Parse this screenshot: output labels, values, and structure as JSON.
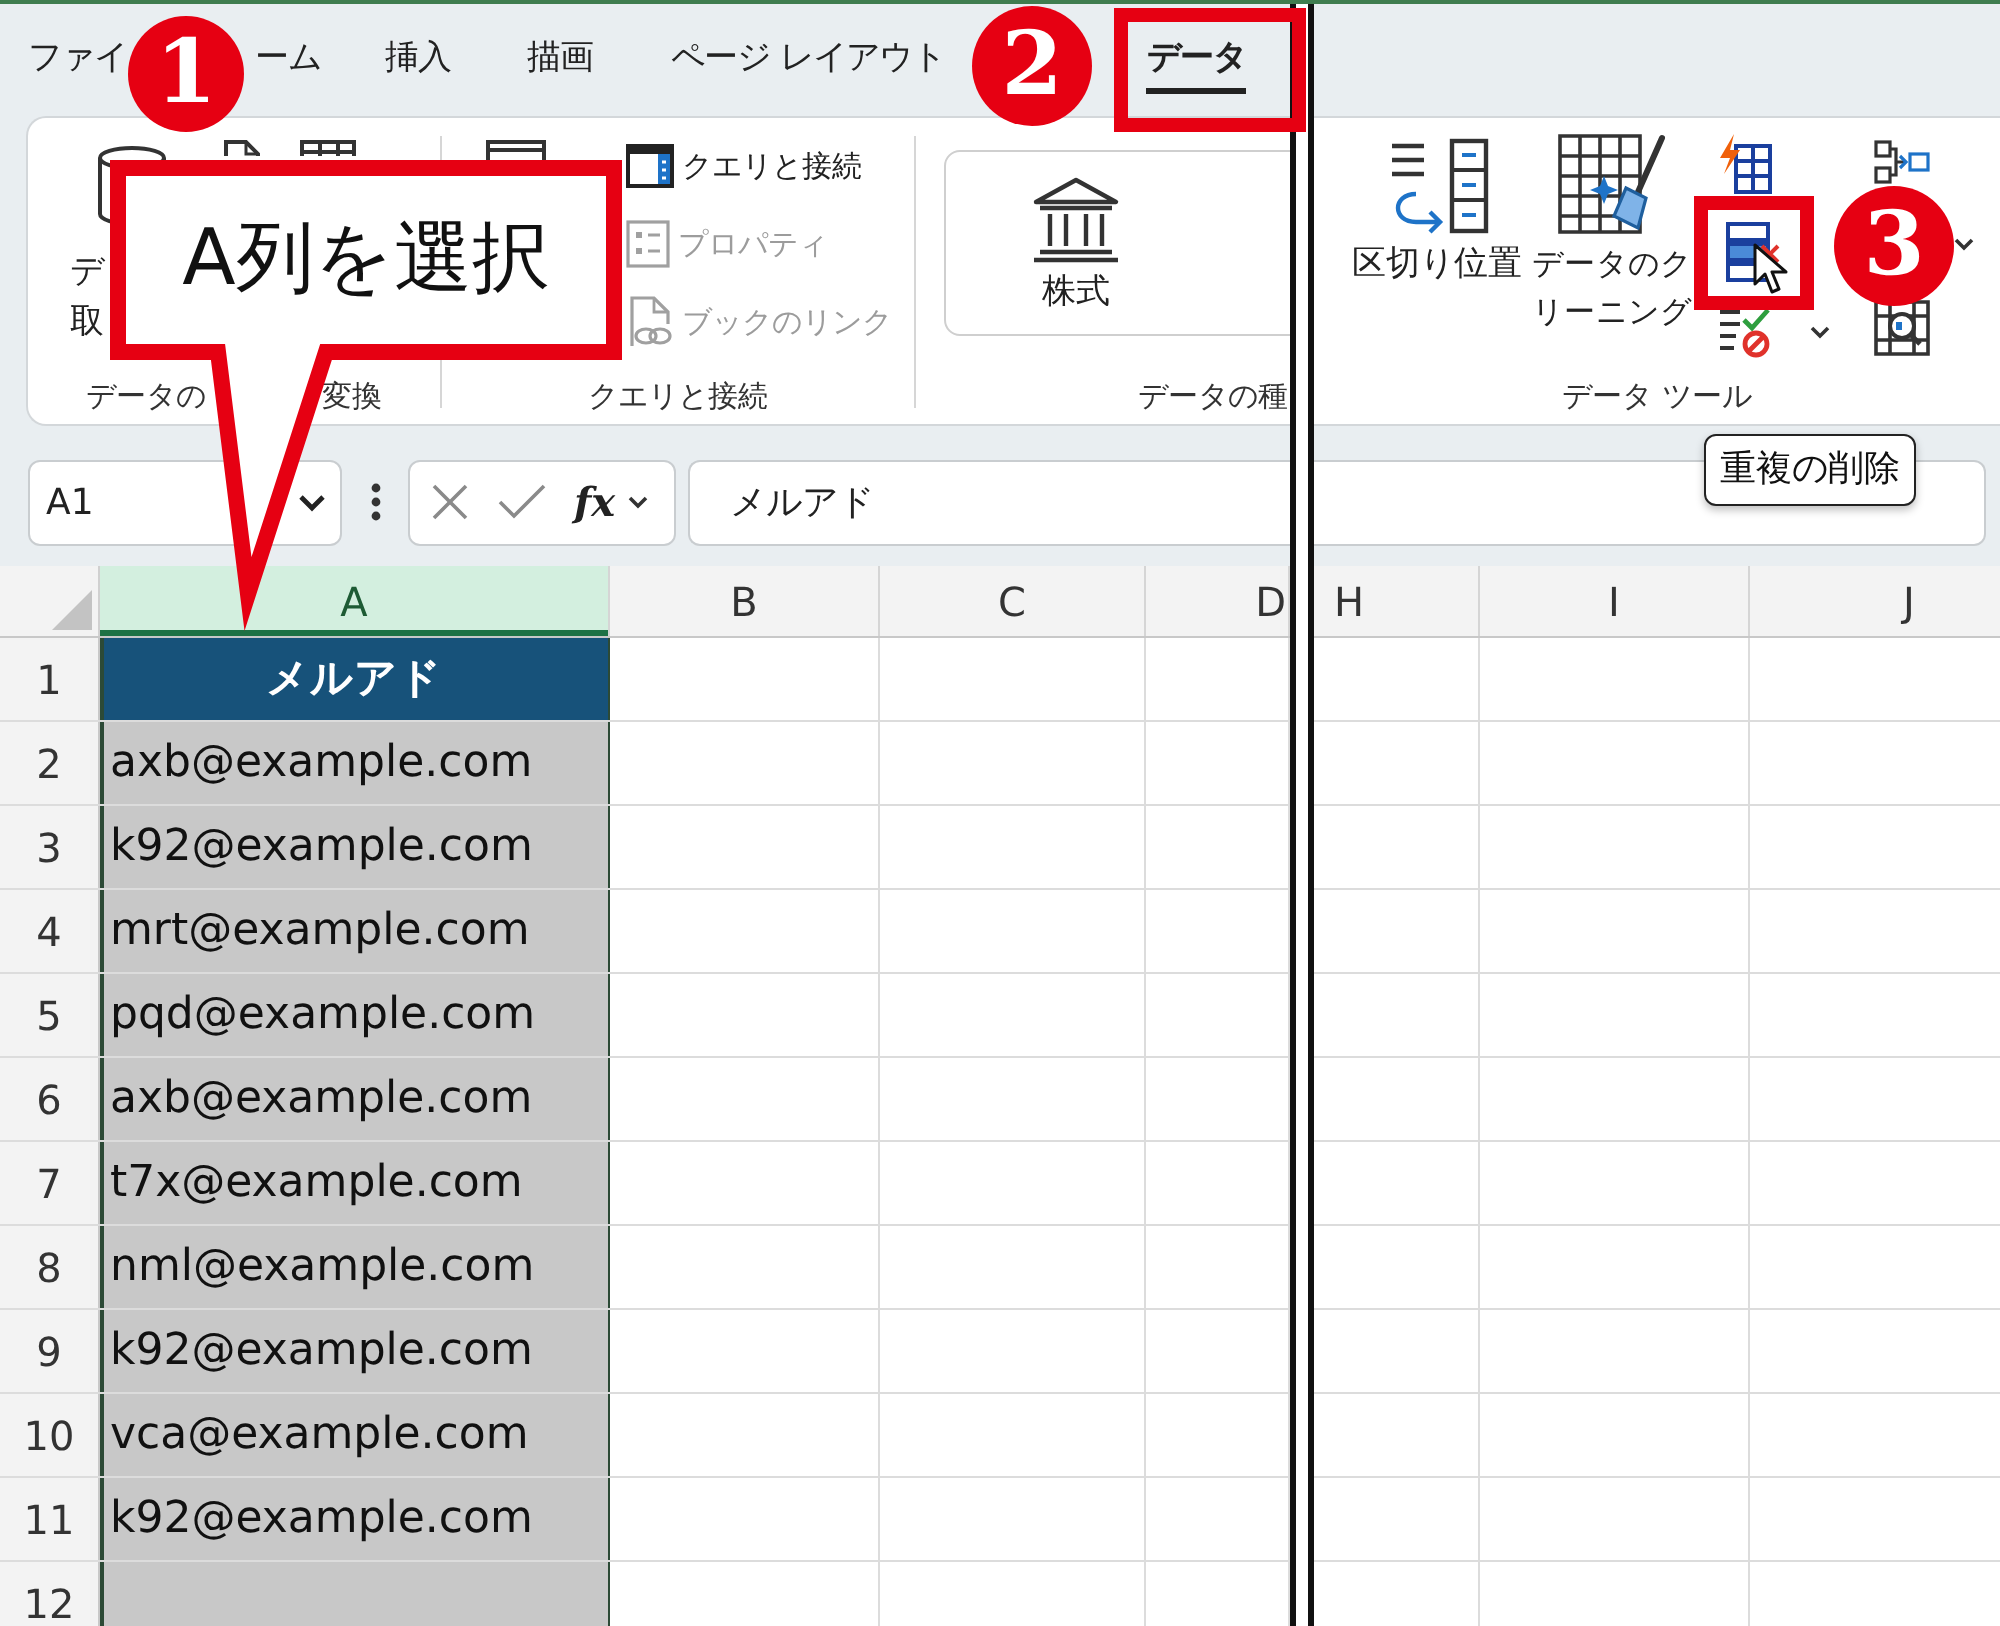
{
  "left_pane": {
    "tabs": [
      {
        "label": "ファイ",
        "selected": false
      },
      {
        "label": "ーム",
        "selected": false
      },
      {
        "label": "挿入",
        "selected": false
      },
      {
        "label": "描画",
        "selected": false
      },
      {
        "label": "ページ レイアウト",
        "selected": false
      },
      {
        "label": "データ",
        "selected": true
      }
    ],
    "ribbon_groups": [
      {
        "kind": "get_data",
        "button_lines": [
          "デ",
          "取"
        ],
        "label_parts": [
          "データの",
          "変換"
        ]
      },
      {
        "kind": "queries",
        "items": [
          {
            "kind": "connections",
            "label": "クエリと接続",
            "disabled": false
          },
          {
            "kind": "properties",
            "label": "プロパティ",
            "disabled": true
          },
          {
            "kind": "links",
            "label": "ブックのリンク",
            "disabled": true
          }
        ],
        "label": "クエリと接続"
      },
      {
        "kind": "data_types",
        "button": "株式",
        "label": "データの種"
      }
    ],
    "formula_bar": {
      "name_box": "A1",
      "function_label": "fx",
      "formula": "メルアド"
    },
    "columns": [
      {
        "label": "A",
        "selected": true
      },
      {
        "label": "B",
        "selected": false
      },
      {
        "label": "C",
        "selected": false
      },
      {
        "label": "D",
        "selected": false
      }
    ],
    "rows": [
      {
        "number": "1",
        "kind": "header",
        "cells": [
          "メルアド"
        ]
      },
      {
        "number": "2",
        "kind": "data",
        "cells": [
          "axb@example.com"
        ]
      },
      {
        "number": "3",
        "kind": "data",
        "cells": [
          "k92@example.com"
        ]
      },
      {
        "number": "4",
        "kind": "data",
        "cells": [
          "mrt@example.com"
        ]
      },
      {
        "number": "5",
        "kind": "data",
        "cells": [
          "pqd@example.com"
        ]
      },
      {
        "number": "6",
        "kind": "data",
        "cells": [
          "axb@example.com"
        ]
      },
      {
        "number": "7",
        "kind": "data",
        "cells": [
          "t7x@example.com"
        ]
      },
      {
        "number": "8",
        "kind": "data",
        "cells": [
          "nml@example.com"
        ]
      },
      {
        "number": "9",
        "kind": "data",
        "cells": [
          "k92@example.com"
        ]
      },
      {
        "number": "10",
        "kind": "data",
        "cells": [
          "vca@example.com"
        ]
      },
      {
        "number": "11",
        "kind": "data",
        "cells": [
          "k92@example.com"
        ]
      },
      {
        "number": "12",
        "kind": "data"
      }
    ]
  },
  "right_pane": {
    "ribbon_groups": [
      {
        "kind": "data_tools",
        "buttons": [
          {
            "kind": "text_to_columns",
            "lines": [
              "区切り位置"
            ]
          },
          {
            "kind": "data_cleaning",
            "lines": [
              "データのク",
              "リーニング"
            ]
          }
        ],
        "label": "データ ツール"
      }
    ],
    "columns": [
      {
        "label": "H",
        "selected": false
      },
      {
        "label": "I",
        "selected": false
      },
      {
        "label": "J",
        "selected": false
      }
    ]
  },
  "annotations": {
    "steps": [
      "1",
      "2",
      "3"
    ],
    "callout": "A列を選択"
  },
  "tooltip": "重複の削除"
}
